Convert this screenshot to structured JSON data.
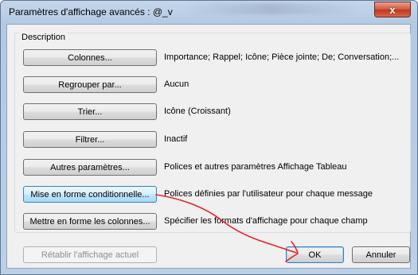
{
  "window": {
    "title": "Paramètres d'affichage avancés : @_v",
    "close_glyph": "x"
  },
  "group": {
    "label": "Description"
  },
  "rows": [
    {
      "button": "Colonnes...",
      "value": "Importance; Rappel; Icône; Pièce jointe; De; Conversation;..."
    },
    {
      "button": "Regrouper par...",
      "value": "Aucun"
    },
    {
      "button": "Trier...",
      "value": "Icône (Croissant)"
    },
    {
      "button": "Filtrer...",
      "value": "Inactif"
    },
    {
      "button": "Autres paramètres...",
      "value": "Polices et autres paramètres Affichage Tableau"
    },
    {
      "button": "Mise en forme conditionnelle...",
      "value": "Polices définies par l'utilisateur pour chaque message"
    },
    {
      "button": "Mettre en forme les colonnes...",
      "value": "Spécifier les formats d'affichage pour chaque champ"
    }
  ],
  "footer": {
    "reset_label": "Rétablir l'affichage actuel",
    "ok_label": "OK",
    "cancel_label": "Annuler"
  },
  "annotation": {
    "color": "#e8202a"
  }
}
